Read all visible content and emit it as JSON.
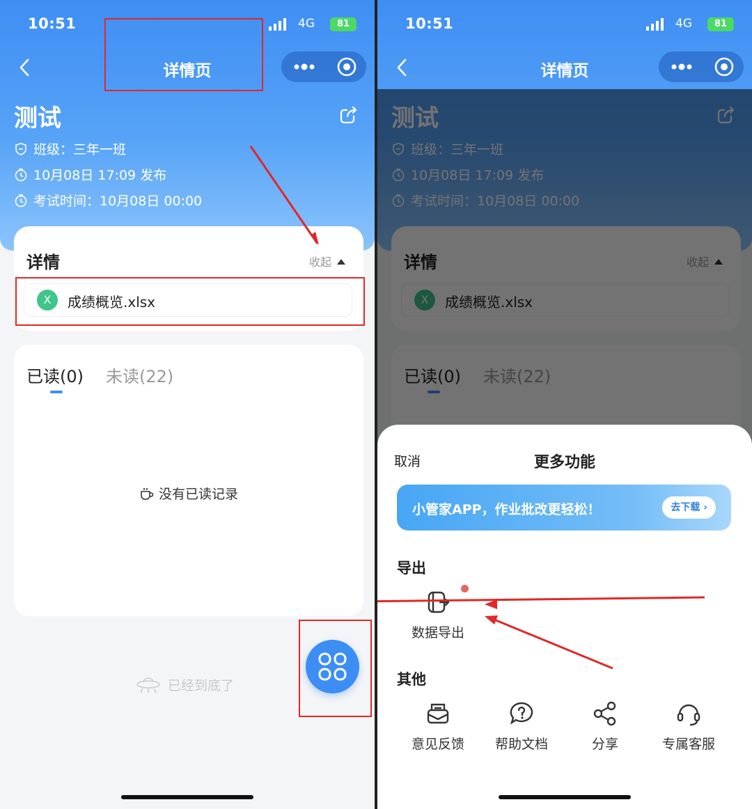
{
  "status": {
    "time": "10:51",
    "network": "4G",
    "battery": "81"
  },
  "nav": {
    "title": "详情页"
  },
  "task": {
    "title": "测试",
    "class_label": "班级：三年一班",
    "publish": "10月08日 17:09 发布",
    "exam_time": "考试时间：10月08日 00:00"
  },
  "details": {
    "title": "详情",
    "collapse_label": "收起",
    "file": {
      "icon_letter": "X",
      "name": "成绩概览.xlsx"
    }
  },
  "read_tabs": {
    "read": "已读(0)",
    "unread": "未读(22)",
    "empty": "没有已读记录"
  },
  "footer_tip": "已经到底了",
  "sheet": {
    "cancel": "取消",
    "title": "更多功能",
    "banner_text": "小管家APP，作业批改更轻松！",
    "banner_button": "去下载 ›",
    "export_group": "导出",
    "export_action": "数据导出",
    "other_group": "其他",
    "other_actions": [
      "意见反馈",
      "帮助文档",
      "分享",
      "专属客服"
    ]
  },
  "colors": {
    "primary": "#3d8ef4",
    "annotation": "#e02828",
    "excel_green": "#3fc48a"
  },
  "icons": [
    "back-icon",
    "more-dots-icon",
    "close-target-icon",
    "share-icon",
    "shield-icon",
    "clock-icon",
    "excel-icon",
    "cup-icon",
    "ufo-icon",
    "grid-menu-icon",
    "export-icon",
    "feedback-icon",
    "help-icon",
    "share-nodes-icon",
    "headset-icon"
  ]
}
